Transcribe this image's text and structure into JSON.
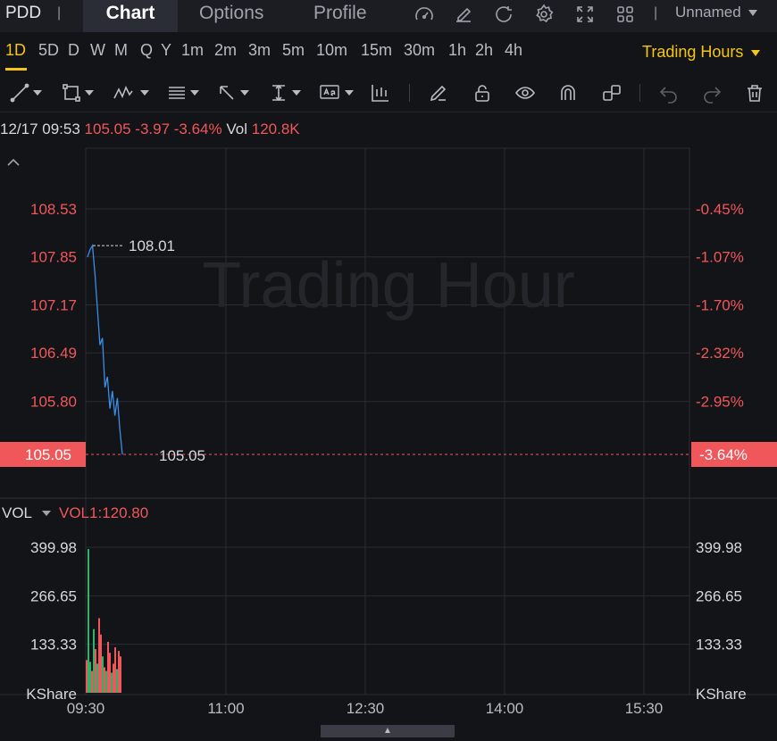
{
  "header": {
    "symbol": "PDD",
    "separator": "|",
    "tabs": [
      {
        "label": "Chart",
        "active": true
      },
      {
        "label": "Options",
        "active": false
      },
      {
        "label": "Profile",
        "active": false
      }
    ],
    "icons": [
      "gauge-icon",
      "edit-icon",
      "refresh-icon",
      "gear-icon",
      "expand-icon",
      "grid-icon"
    ],
    "layout_name": "Unnamed"
  },
  "periods": {
    "items": [
      "1D",
      "5D",
      "D",
      "W",
      "M",
      "Q",
      "Y",
      "1m",
      "2m",
      "3m",
      "5m",
      "10m",
      "15m",
      "30m",
      "1h",
      "2h",
      "4h"
    ],
    "active": "1D",
    "session": "Trading Hours"
  },
  "tools": [
    "trend-line-icon",
    "rectangle-icon",
    "pattern-icon",
    "fib-icon",
    "arrow-icon",
    "measure-icon",
    "text-icon",
    "indicator-icon",
    "pencil-icon",
    "lock-icon",
    "eye-icon",
    "magnet-icon",
    "link-icon",
    "undo-icon",
    "redo-icon",
    "trash-icon"
  ],
  "info": {
    "datetime": "12/17 09:53",
    "price": "105.05",
    "change": "-3.97",
    "change_pct": "-3.64%",
    "vol_label": "Vol",
    "vol_value": "120.8K"
  },
  "chart_data": {
    "type": "line",
    "watermark": "Trading Hour",
    "price_ticks": [
      "108.53",
      "107.85",
      "107.17",
      "106.49",
      "105.80"
    ],
    "pct_ticks": [
      "-0.45%",
      "-1.07%",
      "-1.70%",
      "-2.32%",
      "-2.95%"
    ],
    "current_price": "105.05",
    "current_pct": "-3.64%",
    "high_label": "108.01",
    "last_label": "105.05",
    "ylim": [
      105.05,
      108.53
    ],
    "x_ticks": [
      "09:30",
      "11:00",
      "12:30",
      "14:00",
      "15:30"
    ],
    "price_series": [
      107.85,
      107.95,
      108.01,
      107.6,
      107.1,
      106.6,
      106.7,
      106.0,
      106.15,
      105.7,
      105.95,
      105.6,
      105.85,
      105.4,
      105.05
    ],
    "volume": {
      "indicator": "VOL",
      "label": "VOL1:120.80",
      "ticks": [
        "399.98",
        "266.65",
        "133.33"
      ],
      "unit": "KShare",
      "ylim": [
        0,
        399.98
      ],
      "bars": [
        {
          "v": 90,
          "c": "red"
        },
        {
          "v": 395,
          "c": "green"
        },
        {
          "v": 85,
          "c": "green"
        },
        {
          "v": 60,
          "c": "red"
        },
        {
          "v": 175,
          "c": "green"
        },
        {
          "v": 120,
          "c": "red"
        },
        {
          "v": 80,
          "c": "green"
        },
        {
          "v": 205,
          "c": "red"
        },
        {
          "v": 160,
          "c": "red"
        },
        {
          "v": 100,
          "c": "green"
        },
        {
          "v": 70,
          "c": "red"
        },
        {
          "v": 60,
          "c": "green"
        },
        {
          "v": 140,
          "c": "red"
        },
        {
          "v": 110,
          "c": "red"
        },
        {
          "v": 55,
          "c": "green"
        },
        {
          "v": 80,
          "c": "red"
        },
        {
          "v": 125,
          "c": "red"
        },
        {
          "v": 65,
          "c": "green"
        },
        {
          "v": 115,
          "c": "red"
        },
        {
          "v": 100,
          "c": "red"
        }
      ]
    }
  },
  "colors": {
    "accent": "#f5c518",
    "down": "#f0575a",
    "up": "#2fb36a",
    "line": "#3a8ee6"
  }
}
